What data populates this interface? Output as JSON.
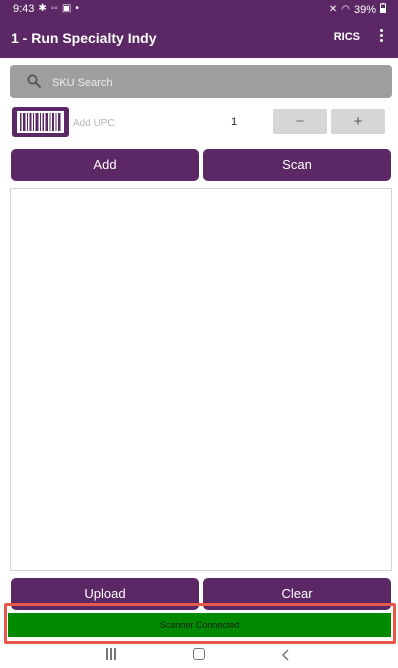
{
  "status_bar": {
    "time": "9:43",
    "battery": "39%"
  },
  "app_bar": {
    "title": "1 - Run Specialty Indy",
    "action_label": "RICS"
  },
  "search": {
    "placeholder": "SKU Search"
  },
  "upc": {
    "placeholder": "Add UPC",
    "quantity": "1",
    "minus_label": "−",
    "plus_label": "+"
  },
  "actions": {
    "add_label": "Add",
    "scan_label": "Scan",
    "upload_label": "Upload",
    "clear_label": "Clear"
  },
  "scanner": {
    "status_text": "Scanner Connected",
    "status_color": "#008a00"
  },
  "colors": {
    "primary": "#5b2764",
    "search_bg": "#9e9e9e",
    "highlight": "#e8584a"
  },
  "icons": {
    "status_left": [
      "gear-icon",
      "voicemail-icon",
      "cast-icon",
      "dot-icon"
    ],
    "status_right": [
      "mute-icon",
      "wifi-icon",
      "battery-icon"
    ],
    "app_bar": [
      "overflow-menu-icon"
    ],
    "search": "search-icon",
    "barcode": "barcode-icon",
    "nav": [
      "recent-apps-icon",
      "home-icon",
      "back-icon"
    ]
  }
}
